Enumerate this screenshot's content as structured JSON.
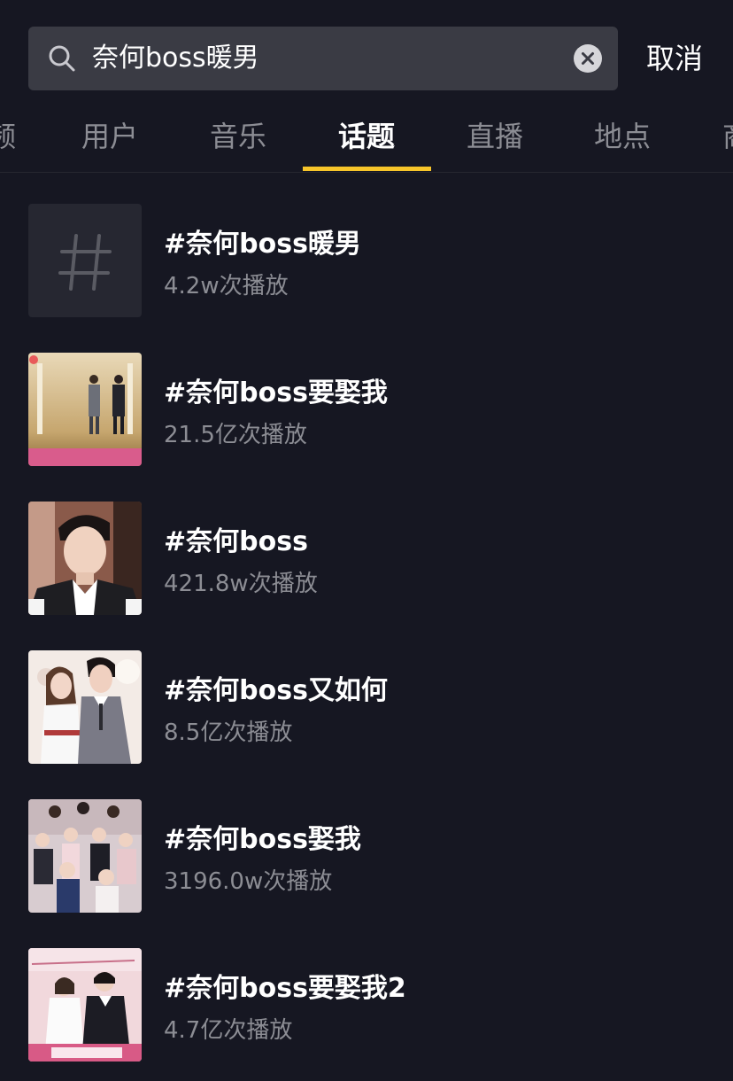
{
  "search": {
    "query": "奈何boss暖男",
    "cancel_label": "取消"
  },
  "tabs": [
    {
      "label": "频"
    },
    {
      "label": "用户"
    },
    {
      "label": "音乐"
    },
    {
      "label": "话题",
      "active": true
    },
    {
      "label": "直播"
    },
    {
      "label": "地点"
    },
    {
      "label": "商"
    }
  ],
  "results": [
    {
      "title": "#奈何boss暖男",
      "plays": "4.2w次播放",
      "thumb": "hashtag-icon"
    },
    {
      "title": "#奈何boss要娶我",
      "plays": "21.5亿次播放",
      "thumb": "cover-image"
    },
    {
      "title": "#奈何boss",
      "plays": "421.8w次播放",
      "thumb": "cover-image"
    },
    {
      "title": "#奈何boss又如何",
      "plays": "8.5亿次播放",
      "thumb": "cover-image"
    },
    {
      "title": "#奈何boss娶我",
      "plays": "3196.0w次播放",
      "thumb": "cover-image"
    },
    {
      "title": "#奈何boss要娶我2",
      "plays": "4.7亿次播放",
      "thumb": "cover-image"
    }
  ],
  "colors": {
    "background": "#161722",
    "tab_indicator": "#f7c52a",
    "secondary_text": "#8c8d94"
  }
}
